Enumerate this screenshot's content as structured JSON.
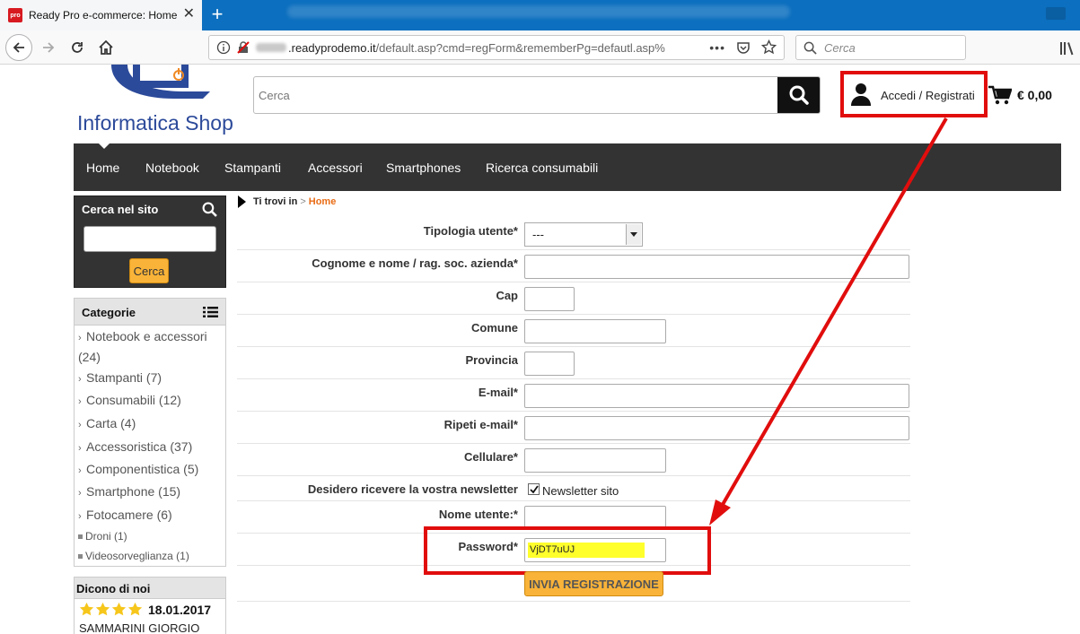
{
  "browser": {
    "tab_title": "Ready Pro e-commerce: Home",
    "favicon_text": "pro",
    "url_domain": ".readyprodemo.it",
    "url_path": "/default.asp?cmd=regForm&rememberPg=defautl.asp%",
    "search_placeholder": "Cerca"
  },
  "header": {
    "logo_text": "Informatica Shop",
    "search_placeholder": "Cerca",
    "account_label": "Accedi / Registrati",
    "cart_total": "€ 0,00"
  },
  "menu": {
    "items": [
      "Home",
      "Notebook",
      "Stampanti",
      "Accessori",
      "Smartphones",
      "Ricerca consumabili"
    ]
  },
  "sidebar": {
    "search_title": "Cerca nel sito",
    "search_button": "Cerca",
    "categories_title": "Categorie",
    "categories": [
      "Notebook e accessori (24)",
      "Stampanti (7)",
      "Consumabili (12)",
      "Carta (4)",
      "Accessoristica (37)",
      "Componentistica (5)",
      "Smartphone (15)",
      "Fotocamere (6)"
    ],
    "subcategories": [
      "Droni (1)",
      "Videosorveglianza (1)"
    ],
    "reviews_title": "Dicono di noi",
    "review_date": "18.01.2017",
    "review_author": "SAMMARINI GIORGIO",
    "review_rating": 4
  },
  "breadcrumb": {
    "label": "Ti trovi in",
    "sep": ">",
    "current": "Home"
  },
  "form": {
    "labels": {
      "tipologia": "Tipologia utente*",
      "cognome": "Cognome e nome / rag. soc. azienda*",
      "cap": "Cap",
      "comune": "Comune",
      "provincia": "Provincia",
      "email": "E-mail*",
      "ripeti_email": "Ripeti e-mail*",
      "cellulare": "Cellulare*",
      "newsletter": "Desidero ricevere la vostra newsletter",
      "username": "Nome utente:*",
      "password": "Password*"
    },
    "tipologia_value": "---",
    "newsletter_option": "Newsletter sito",
    "newsletter_checked": true,
    "password_value": "VjDT7uUJ",
    "submit_label": "INVIA REGISTRAZIONE"
  },
  "colors": {
    "accent": "#f9b338",
    "highlight_box": "#e10d0d",
    "menu_bg": "#333333",
    "breadcrumb_home": "#e96c16"
  }
}
